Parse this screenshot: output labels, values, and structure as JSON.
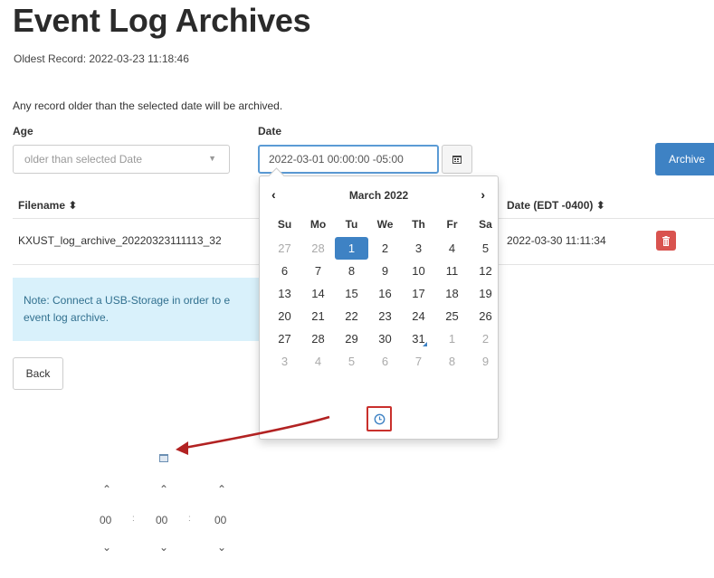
{
  "page": {
    "title": "Event Log Archives",
    "oldest_record": "Oldest Record: 2022-03-23 11:18:46",
    "info": "Any record older than the selected date will be archived."
  },
  "form": {
    "age_label": "Age",
    "age_value": "older than selected Date",
    "date_label": "Date",
    "date_value": "2022-03-01 00:00:00 -05:00",
    "archive_label": "Archive"
  },
  "table": {
    "columns": [
      "Filename ⬍",
      "Date (EDT -0400) ⬍"
    ],
    "rows": [
      {
        "filename": "KXUST_log_archive_20220323111113_32",
        "date": "2022-03-30 11:11:34"
      }
    ]
  },
  "note": {
    "text": "Note: Connect a USB-Storage in order to e\nevent log archive."
  },
  "back_label": "Back",
  "calendar": {
    "prev": "‹",
    "next": "›",
    "month_label": "March 2022",
    "weekdays": [
      "Su",
      "Mo",
      "Tu",
      "We",
      "Th",
      "Fr",
      "Sa"
    ],
    "weeks": [
      [
        "27",
        "28",
        "1",
        "2",
        "3",
        "4",
        "5"
      ],
      [
        "6",
        "7",
        "8",
        "9",
        "10",
        "11",
        "12"
      ],
      [
        "13",
        "14",
        "15",
        "16",
        "17",
        "18",
        "19"
      ],
      [
        "20",
        "21",
        "22",
        "23",
        "24",
        "25",
        "26"
      ],
      [
        "27",
        "28",
        "29",
        "30",
        "31",
        "1",
        "2"
      ],
      [
        "3",
        "4",
        "5",
        "6",
        "7",
        "8",
        "9"
      ]
    ],
    "selected": "1",
    "today": "31"
  },
  "timepicker": {
    "up": "⌃",
    "down": "⌄",
    "values": [
      "00",
      "00",
      "00"
    ],
    "separator": ":"
  },
  "colors": {
    "accent": "#3e82c4",
    "danger": "#d9534f",
    "note_bg": "#d9f1fb",
    "arrow": "#b22222"
  },
  "icons": {
    "calendar_button": "calendar-icon",
    "delete": "trash-icon",
    "time_toggle": "clock-icon",
    "timepicker_toggle": "calendar-small-icon"
  }
}
